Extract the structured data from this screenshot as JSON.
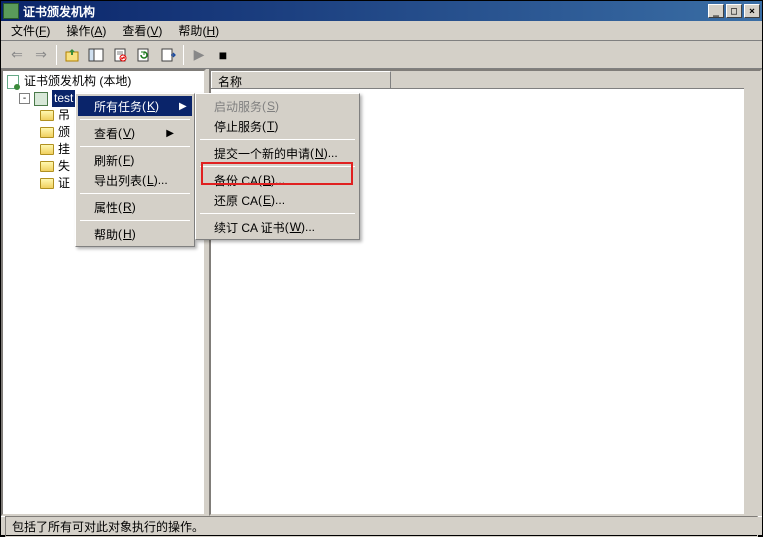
{
  "titlebar": {
    "title": "证书颁发机构"
  },
  "menubar": {
    "file": {
      "label": "文件",
      "accel": "F"
    },
    "action": {
      "label": "操作",
      "accel": "A"
    },
    "view": {
      "label": "查看",
      "accel": "V"
    },
    "help": {
      "label": "帮助",
      "accel": "H"
    }
  },
  "tree": {
    "root": "证书颁发机构 (本地)",
    "ca": "test",
    "children": [
      "吊",
      "颁",
      "挂",
      "失",
      "证"
    ]
  },
  "list": {
    "col_name": "名称"
  },
  "context_menu_1": {
    "all_tasks": {
      "label": "所有任务",
      "accel": "K"
    },
    "view": {
      "label": "查看",
      "accel": "V"
    },
    "refresh": {
      "label": "刷新",
      "accel": "F"
    },
    "export_list": {
      "label": "导出列表",
      "accel": "L",
      "suffix": "..."
    },
    "properties": {
      "label": "属性",
      "accel": "R"
    },
    "help": {
      "label": "帮助",
      "accel": "H"
    }
  },
  "context_menu_2": {
    "start_service": {
      "label": "启动服务",
      "accel": "S"
    },
    "stop_service": {
      "label": "停止服务",
      "accel": "T"
    },
    "submit": {
      "label": "提交一个新的申请",
      "accel": "N",
      "suffix": "..."
    },
    "backup_ca": {
      "label": "备份 CA",
      "accel": "B",
      "suffix": "..."
    },
    "restore_ca": {
      "label": "还原 CA",
      "accel": "E",
      "suffix": "..."
    },
    "renew_ca": {
      "label": "续订 CA 证书",
      "accel": "W",
      "suffix": "..."
    }
  },
  "statusbar": {
    "text": "包括了所有可对此对象执行的操作。"
  }
}
